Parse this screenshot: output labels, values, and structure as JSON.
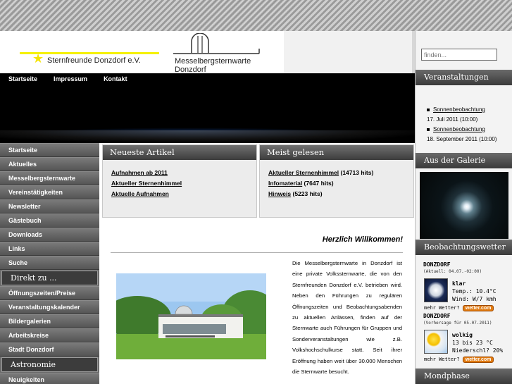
{
  "header": {
    "club_name": "Sternfreunde Donzdorf e.V.",
    "observatory_name_line1": "Messelbergsternwarte",
    "observatory_name_line2": "Donzdorf"
  },
  "topnav": [
    "Startseite",
    "Impressum",
    "Kontakt"
  ],
  "leftmenu": {
    "items_a": [
      "Startseite",
      "Aktuelles",
      "Messelbergsternwarte",
      "Vereinstätigkeiten",
      "Newsletter",
      "Gästebuch",
      "Downloads",
      "Links",
      "Suche"
    ],
    "heading_direkt": "Direkt zu ...",
    "items_b": [
      "Öffnungszeiten/Preise",
      "Veranstaltungskalender",
      "Bildergalerien",
      "Arbeitskreise",
      "Stadt Donzdorf"
    ],
    "heading_astronomie": "Astronomie",
    "items_c": [
      "Neuigkeiten"
    ]
  },
  "neueste": {
    "title": "Neueste Artikel",
    "items": [
      "Aufnahmen ab 2011",
      "Aktueller Sternenhimmel",
      "Aktuelle Aufnahmen"
    ]
  },
  "meist": {
    "title": "Meist gelesen",
    "items": [
      {
        "link": "Aktueller Sternenhimmel",
        "hits": " (14713 hits)"
      },
      {
        "link": "Infomaterial",
        "hits": " (7647 hits)"
      },
      {
        "link": "Hinweis",
        "hits": " (5223 hits)"
      }
    ]
  },
  "main": {
    "welcome": "Herzlich Willkommen!",
    "intro": "Die Messelbergsternwarte in Donzdorf ist eine private Volkssternwarte, die von den Sternfreunden Donzdorf e.V. betrieben wird. Neben den Führungen zu regulären Öffnungszeiten und Beobachtungsabenden zu aktuellen Anlässen, finden auf der Sternwarte auch Führungen für Gruppen und Sonderveranstaltungen wie z.B. Volkshochschulkurse statt. Seit ihrer Eröffnung haben weit über 30.000 Menschen die Sternwarte besucht."
  },
  "sidebar": {
    "search_placeholder": "finden...",
    "veranstaltungen_title": "Veranstaltungen",
    "events": [
      {
        "name": "Sonnenbeobachtung",
        "date": "17. Juli 2011 (10:00)"
      },
      {
        "name": "Sonnenbeobachtung",
        "date": "18. September 2011 (10:00)"
      }
    ],
    "galerie_title": "Aus der Galerie",
    "wetter_title": "Beobachtungswetter",
    "weather": [
      {
        "city": "DONZDORF",
        "sub": "(Aktuell: 04.07.-02:00)",
        "line1": "klar",
        "line2": "Temp.: 10.4°C",
        "line3": "Wind: W/7 kmh",
        "more": "mehr Wetter?",
        "badge": "wetter.com"
      },
      {
        "city": "DONZDORF",
        "sub": "(Vorhersage für 05.07.2011)",
        "line1": "wolkig",
        "line2": "13 bis 23 °C",
        "line3": "Niederschl? 20%",
        "more": "mehr Wetter?",
        "badge": "wetter.com"
      }
    ],
    "mondphase_title": "Mondphase"
  }
}
